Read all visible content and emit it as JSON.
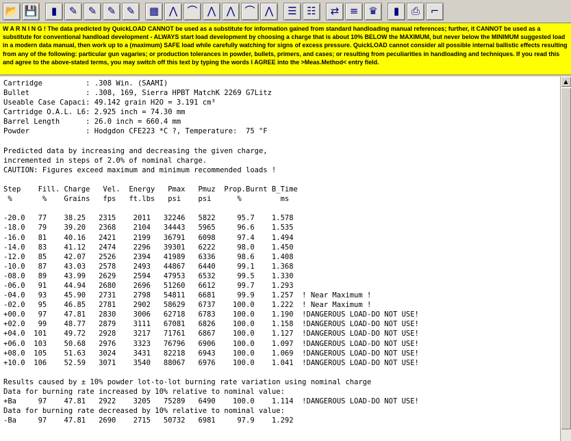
{
  "toolbar": {
    "buttons": [
      {
        "name": "open-icon",
        "glyph": "📂"
      },
      {
        "name": "save-icon",
        "glyph": "💾"
      },
      {
        "name": "cartridge-data-icon",
        "glyph": "▮"
      },
      {
        "name": "bullet-data-icon",
        "glyph": "✎"
      },
      {
        "name": "powder-data-icon",
        "glyph": "✎"
      },
      {
        "name": "edit-data-icon",
        "glyph": "✎"
      },
      {
        "name": "edit-data-2-icon",
        "glyph": "✎"
      },
      {
        "name": "table-icon",
        "glyph": "▦"
      },
      {
        "name": "pressure-chart-icon",
        "glyph": "⋀"
      },
      {
        "name": "velocity-chart-icon",
        "glyph": "⌒"
      },
      {
        "name": "pressure-velocity-chart-icon",
        "glyph": "⋀"
      },
      {
        "name": "energy-chart-icon",
        "glyph": "⋀"
      },
      {
        "name": "burn-chart-icon",
        "glyph": "⌒"
      },
      {
        "name": "combined-chart-icon",
        "glyph": "⋀"
      },
      {
        "name": "text-output-icon",
        "glyph": "☰"
      },
      {
        "name": "list-output-icon",
        "glyph": "☷"
      },
      {
        "name": "compare-icon",
        "glyph": "⇄"
      },
      {
        "name": "ladder-icon",
        "glyph": "≡"
      },
      {
        "name": "medal-icon",
        "glyph": "♛"
      },
      {
        "name": "cartridges-icon",
        "glyph": "▮"
      },
      {
        "name": "print-icon",
        "glyph": "⎙"
      },
      {
        "name": "pistol-icon",
        "glyph": "⌐"
      }
    ]
  },
  "warning": {
    "text": "W A R N I N G ! The data predicted by QuickLOAD CANNOT be used as a substitute for information gained from standard handloading manual references; further, it CANNOT be used as a substitute for conventional handload development - ALWAYS start load development by choosing a charge that is about 10% BELOW the MAXIMUM, but never below the MINIMUM suggested load in a modern data manual, then work up to a (maximum) SAFE load while carefully watching for signs of excess pressure. QuickLOAD cannot consider all possible internal ballistic effects resulting from any of the following: particular gun vagaries; or production tolerances in powder, bullets, primers, and cases; or resulting from peculiarities in handloading and techniques. If you read this and agree to the above-stated terms, you may switch off this text by typing the words I AGREE into the >Meas.Method< entry field."
  },
  "output": {
    "lines": [
      "Cartridge          : .308 Win. (SAAMI)",
      "Bullet             : .308, 169, Sierra HPBT MatchK 2269 G7Litz",
      "Useable Case Capaci: 49.142 grain H2O = 3.191 cm³",
      "Cartridge O.A.L. L6: 2.925 inch = 74.30 mm",
      "Barrel Length      : 26.0 inch = 660.4 mm",
      "Powder             : Hodgdon CFE223 *C ?, Temperature:  75 °F",
      "",
      "Predicted data by increasing and decreasing the given charge,",
      "incremented in steps of 2.0% of nominal charge.",
      "CAUTION: Figures exceed maximum and minimum recommended loads !",
      "",
      "Step    Fill. Charge   Vel.  Energy   Pmax   Pmuz  Prop.Burnt B_Time",
      " %       %    Grains   fps   ft.lbs   psi    psi      %         ms",
      "",
      "-20.0   77    38.25   2315    2011   32246   5822     95.7    1.578",
      "-18.0   79    39.20   2368    2104   34443   5965     96.6    1.535",
      "-16.0   81    40.16   2421    2199   36791   6098     97.4    1.494",
      "-14.0   83    41.12   2474    2296   39301   6222     98.0    1.450",
      "-12.0   85    42.07   2526    2394   41989   6336     98.6    1.408",
      "-10.0   87    43.03   2578    2493   44867   6440     99.1    1.368",
      "-08.0   89    43.99   2629    2594   47953   6532     99.5    1.330",
      "-06.0   91    44.94   2680    2696   51260   6612     99.7    1.293",
      "-04.0   93    45.90   2731    2798   54811   6681     99.9    1.257  ! Near Maximum !",
      "-02.0   95    46.85   2781    2902   58629   6737    100.0    1.222  ! Near Maximum !",
      "+00.0   97    47.81   2830    3006   62718   6783    100.0    1.190  !DANGEROUS LOAD-DO NOT USE!",
      "+02.0   99    48.77   2879    3111   67081   6826    100.0    1.158  !DANGEROUS LOAD-DO NOT USE!",
      "+04.0  101    49.72   2928    3217   71761   6867    100.0    1.127  !DANGEROUS LOAD-DO NOT USE!",
      "+06.0  103    50.68   2976    3323   76796   6906    100.0    1.097  !DANGEROUS LOAD-DO NOT USE!",
      "+08.0  105    51.63   3024    3431   82218   6943    100.0    1.069  !DANGEROUS LOAD-DO NOT USE!",
      "+10.0  106    52.59   3071    3540   88067   6976    100.0    1.041  !DANGEROUS LOAD-DO NOT USE!",
      "",
      "Results caused by ± 10% powder lot-to-lot burning rate variation using nominal charge",
      "Data for burning rate increased by 10% relative to nominal value:",
      "+Ba     97    47.81   2922    3205   75289   6490    100.0    1.114  !DANGEROUS LOAD-DO NOT USE!",
      "Data for burning rate decreased by 10% relative to nominal value:",
      "-Ba     97    47.81   2690    2715   50732   6981     97.9    1.292"
    ]
  }
}
